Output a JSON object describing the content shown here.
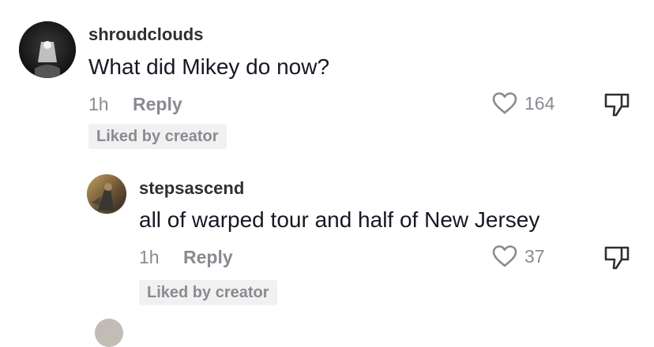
{
  "comments": [
    {
      "username": "shroudclouds",
      "text": "What did Mikey do now?",
      "time": "1h",
      "reply_label": "Reply",
      "likes": "164",
      "badge": "Liked by creator"
    },
    {
      "username": "stepsascend",
      "text": "all of warped tour and half of New Jersey",
      "time": "1h",
      "reply_label": "Reply",
      "likes": "37",
      "badge": "Liked by creator"
    }
  ],
  "icons": {
    "like": "heart-outline-icon",
    "dislike": "thumbs-down-outline-icon"
  },
  "colors": {
    "text": "#161823",
    "muted": "#8a8b91",
    "badge_bg": "#f1f1f2"
  }
}
